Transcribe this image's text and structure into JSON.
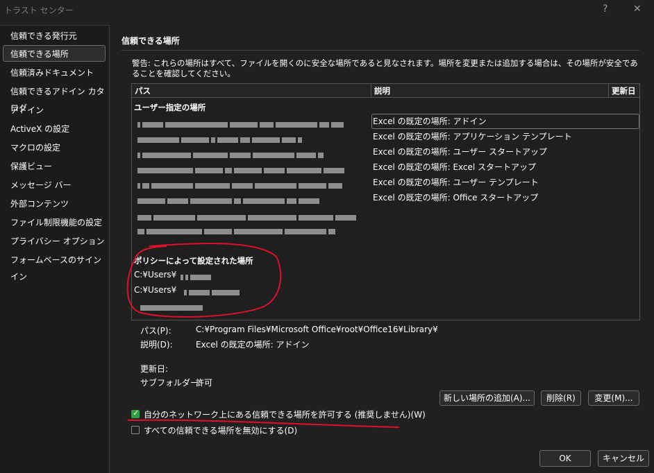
{
  "window": {
    "title": "トラスト センター",
    "help": "?",
    "close": "✕"
  },
  "sidebar": {
    "items": [
      {
        "label": "信頼できる発行元"
      },
      {
        "label": "信頼できる場所",
        "selected": true
      },
      {
        "label": "信頼済みドキュメント"
      },
      {
        "label": "信頼できるアドイン カタログ"
      },
      {
        "label": "アドイン"
      },
      {
        "label": "ActiveX の設定"
      },
      {
        "label": "マクロの設定"
      },
      {
        "label": "保護ビュー"
      },
      {
        "label": "メッセージ バー"
      },
      {
        "label": "外部コンテンツ"
      },
      {
        "label": "ファイル制限機能の設定"
      },
      {
        "label": "プライバシー オプション"
      },
      {
        "label": "フォームベースのサインイン"
      }
    ]
  },
  "main": {
    "section_title": "信頼できる場所",
    "warning": "警告: これらの場所はすべて、ファイルを開くのに安全な場所であると見なされます。場所を変更または追加する場合は、その場所が安全であることを確認してください。",
    "table": {
      "columns": [
        "パス",
        "説明",
        "更新日"
      ],
      "user_group": "ユーザー指定の場所",
      "user_rows": [
        {
          "desc": "Excel の既定の場所: アドイン"
        },
        {
          "desc": "Excel の既定の場所: アプリケーション テンプレート"
        },
        {
          "desc": "Excel の既定の場所: ユーザー スタートアップ"
        },
        {
          "desc": "Excel の既定の場所: Excel スタートアップ"
        },
        {
          "desc": "Excel の既定の場所: ユーザー テンプレート"
        },
        {
          "desc": "Excel の既定の場所: Office スタートアップ"
        }
      ],
      "policy_group": "ポリシーによって設定された場所",
      "policy_rows": [
        {
          "path": "C:¥Users¥"
        },
        {
          "path": "C:¥Users¥"
        }
      ]
    },
    "details": {
      "path_label": "パス(P):",
      "path_value": "C:¥Program Files¥Microsoft Office¥root¥Office16¥Library¥",
      "desc_label": "説明(D):",
      "desc_value": "Excel の既定の場所: アドイン",
      "date_label": "更新日:",
      "subfolder_label": "サブフォルダー:",
      "subfolder_value": "許可"
    },
    "buttons": {
      "add": "新しい場所の追加(A)...",
      "remove": "削除(R)",
      "modify": "変更(M)..."
    },
    "checkboxes": [
      {
        "label": "自分のネットワーク上にある信頼できる場所を許可する (推奨しません)(W)",
        "checked": true
      },
      {
        "label": "すべての信頼できる場所を無効にする(D)",
        "checked": false
      }
    ]
  },
  "footer": {
    "ok": "OK",
    "cancel": "キャンセル"
  },
  "colors": {
    "accent_check": "#2ea043",
    "annotation": "#e0102a"
  }
}
